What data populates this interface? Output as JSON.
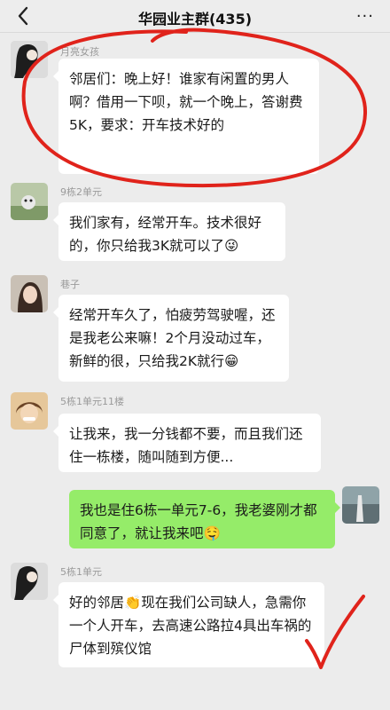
{
  "header": {
    "title": "华园业主群(435)",
    "back_icon": "back-chevron-icon",
    "more_icon": "more-dots-icon",
    "more_symbol": "···"
  },
  "messages": [
    {
      "sender": "月亮女孩",
      "text": "邻居们：晚上好！谁家有闲置的男人啊？借用一下呗，就一个晚上，答谢费5K，要求：开车技术好的"
    },
    {
      "sender": "9栋2单元",
      "text": "我们家有，经常开车。技术很好的，你只给我3K就可以了😜"
    },
    {
      "sender": "巷子",
      "text": "经常开车久了，怕疲劳驾驶喔，还是我老公来嘛！2个月没动过车，新鲜的很，只给我2K就行😁"
    },
    {
      "sender": "5栋1单元11楼",
      "text": "让我来，我一分钱都不要，而且我们还住一栋楼，随叫随到方便..."
    },
    {
      "sender": "",
      "text": "我也是住6栋一单元7-6，我老婆刚才都同意了，就让我来吧🤤"
    },
    {
      "sender": "5栋1单元",
      "text": "好的邻居👏现在我们公司缺人，急需你一个人开车，去高速公路拉4具出车祸的尸体到殡仪馆"
    }
  ],
  "colors": {
    "my_bubble": "#95ec69",
    "other_bubble": "#ffffff",
    "annotation": "#e0231b",
    "background": "#ececec"
  }
}
